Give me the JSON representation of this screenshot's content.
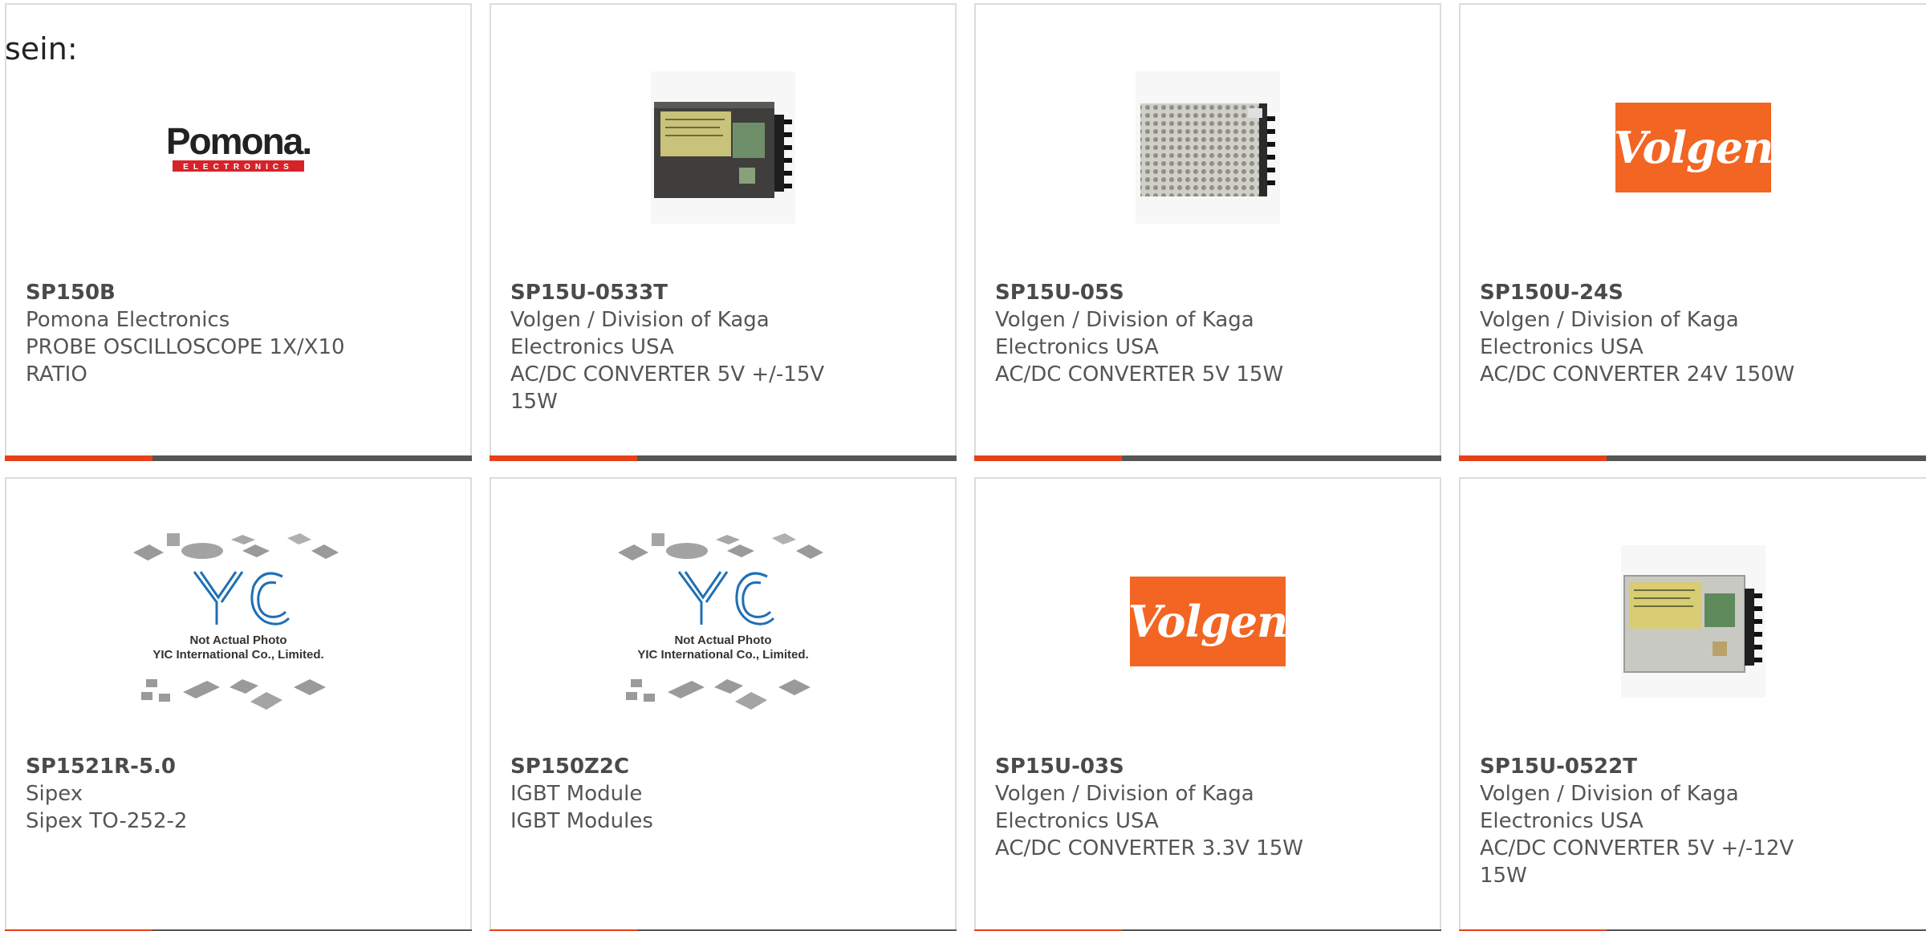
{
  "header": {
    "stray_text": "sein:"
  },
  "colors": {
    "accent": "#e8411a",
    "bar_dark": "#555555",
    "card_border": "#dcdcdc",
    "volgen_orange": "#f26522",
    "text": "#555555"
  },
  "products": [
    {
      "part_number": "SP150B",
      "manufacturer": "Pomona Electronics",
      "description": "PROBE OSCILLOSCOPE 1X/X10 RATIO",
      "image": "pomona-logo",
      "logo_text": "Pomona.",
      "logo_subtext": "ELECTRONICS"
    },
    {
      "part_number": "SP15U-0533T",
      "manufacturer": "Volgen / Division of Kaga Electronics USA",
      "description": "AC/DC CONVERTER 5V +/-15V 15W",
      "image": "enclosed-power-supply-photo"
    },
    {
      "part_number": "SP15U-05S",
      "manufacturer": "Volgen / Division of Kaga Electronics USA",
      "description": "AC/DC CONVERTER 5V 15W",
      "image": "perforated-power-supply-photo"
    },
    {
      "part_number": "SP150U-24S",
      "manufacturer": "Volgen / Division of Kaga Electronics USA",
      "description": "AC/DC CONVERTER 24V 150W",
      "image": "volgen-logo",
      "logo_text": "Volgen"
    },
    {
      "part_number": "SP1521R-5.0",
      "manufacturer": "Sipex",
      "description": "Sipex TO-252-2",
      "image": "yic-not-actual-photo",
      "placeholder_line1": "Not Actual Photo",
      "placeholder_line2": "YIC International Co., Limited."
    },
    {
      "part_number": "SP150Z2C",
      "manufacturer": "IGBT Module",
      "description": "IGBT Modules",
      "image": "yic-not-actual-photo",
      "placeholder_line1": "Not Actual Photo",
      "placeholder_line2": "YIC International Co., Limited."
    },
    {
      "part_number": "SP15U-03S",
      "manufacturer": "Volgen / Division of Kaga Electronics USA",
      "description": "AC/DC CONVERTER 3.3V 15W",
      "image": "volgen-logo",
      "logo_text": "Volgen"
    },
    {
      "part_number": "SP15U-0522T",
      "manufacturer": "Volgen / Division of Kaga Electronics USA",
      "description": "AC/DC CONVERTER 5V +/-12V 15W",
      "image": "silver-power-supply-photo"
    }
  ]
}
